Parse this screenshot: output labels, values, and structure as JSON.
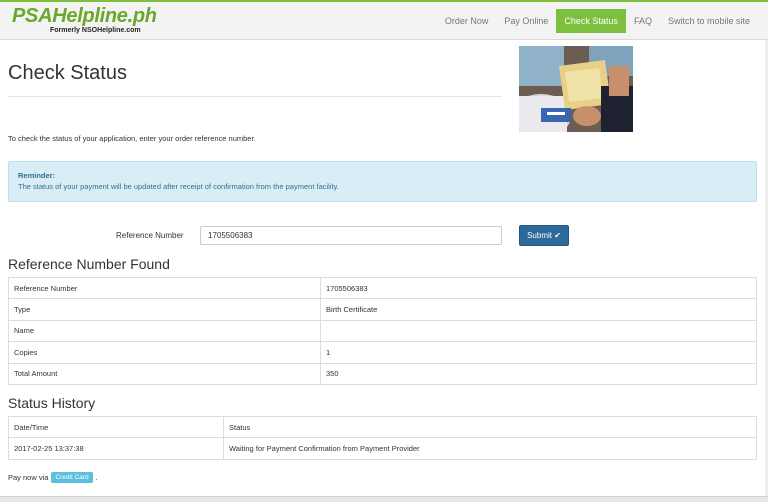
{
  "header": {
    "logo_main": "PSAHelpline.ph",
    "logo_sub": "Formerly NSOHelpline.com",
    "nav": [
      {
        "label": "Order Now",
        "active": false
      },
      {
        "label": "Pay Online",
        "active": false
      },
      {
        "label": "Check Status",
        "active": true
      },
      {
        "label": "FAQ",
        "active": false
      },
      {
        "label": "Switch to mobile site",
        "active": false
      }
    ]
  },
  "page": {
    "title": "Check Status",
    "instruction": "To check the status of your application, enter your order reference number.",
    "reminder_title": "Reminder:",
    "reminder_text": "The status of your payment will be updated after receipt of confirmation from the payment facility."
  },
  "form": {
    "ref_label": "Reference Number",
    "ref_value": "1705506383",
    "submit_label": "Submit"
  },
  "found": {
    "heading": "Reference Number Found",
    "rows": [
      {
        "key": "Reference Number",
        "value": "1705506383"
      },
      {
        "key": "Type",
        "value": "Birth Certificate"
      },
      {
        "key": "Name",
        "value": ""
      },
      {
        "key": "Copies",
        "value": "1"
      },
      {
        "key": "Total Amount",
        "value": "350"
      }
    ]
  },
  "history": {
    "heading": "Status History",
    "columns": [
      "Date/Time",
      "Status"
    ],
    "rows": [
      {
        "datetime": "2017-02-25 13:37:38",
        "status": "Waiting for Payment Confirmation from Payment Provider"
      }
    ]
  },
  "pay": {
    "prefix": "Pay now via",
    "credit_card": "Credit Card",
    "suffix": "."
  },
  "colors": {
    "brand_green": "#7dbf3e",
    "submit_blue": "#2e6a99",
    "reminder_bg": "#d9edf7",
    "cc_button": "#5bc0de"
  }
}
